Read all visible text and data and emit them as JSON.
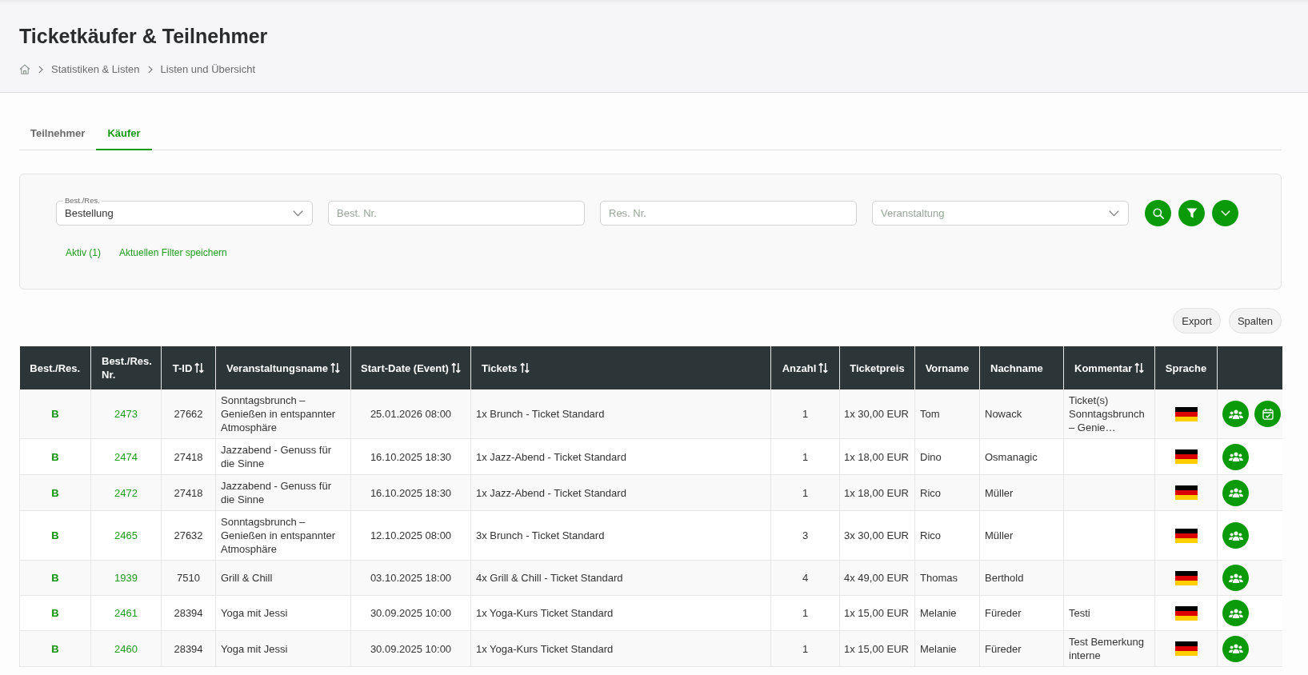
{
  "page": {
    "title": "Ticketkäufer & Teilnehmer",
    "breadcrumb": [
      "Statistiken & Listen",
      "Listen und Übersicht"
    ]
  },
  "tabs": [
    {
      "label": "Teilnehmer",
      "selected": false
    },
    {
      "label": "Käufer",
      "selected": true
    }
  ],
  "filters": {
    "fields": [
      {
        "kind": "select",
        "label": "Best./Res.",
        "value": "Bestellung"
      },
      {
        "kind": "input",
        "placeholder": "Best. Nr."
      },
      {
        "kind": "input",
        "placeholder": "Res. Nr."
      },
      {
        "kind": "select",
        "placeholder": "Veranstaltung"
      }
    ],
    "icon_buttons": [
      {
        "kind": "search"
      },
      {
        "kind": "filter"
      },
      {
        "kind": "expand"
      }
    ],
    "links": [
      "Aktiv (1)",
      "Aktuellen Filter speichern"
    ]
  },
  "toolbar_buttons": [
    "Export",
    "Spalten"
  ],
  "table": {
    "columns": [
      {
        "label": "Best./Res.",
        "sortable": false
      },
      {
        "label": "Best./Res. Nr.",
        "sortable": false
      },
      {
        "label": "T-ID",
        "sortable": true
      },
      {
        "label": "Veranstaltungsname",
        "sortable": true
      },
      {
        "label": "Start-Date (Event)",
        "sortable": true
      },
      {
        "label": "Tickets",
        "sortable": true
      },
      {
        "label": "Anzahl",
        "sortable": true
      },
      {
        "label": "Ticketpreis",
        "sortable": false
      },
      {
        "label": "Vorname",
        "sortable": false
      },
      {
        "label": "Nachname",
        "sortable": false
      },
      {
        "label": "Kommentar",
        "sortable": true
      },
      {
        "label": "Sprache",
        "sortable": false
      }
    ],
    "rows": [
      {
        "type": "B",
        "number": "2473",
        "t_id": "27662",
        "event": "Sonntagsbrunch – Genießen in entspannter Atmosphäre",
        "start": "25.01.2026 08:00",
        "tickets": "1x Brunch - Ticket Standard",
        "count": "1",
        "price": "1x 30,00 EUR",
        "first_name": "Tom",
        "last_name": "Nowack",
        "comment": "Ticket(s) Sonntagsbrunch – Genie…",
        "actions": [
          {
            "kind": "participants"
          },
          {
            "kind": "calendar"
          }
        ]
      },
      {
        "type": "B",
        "number": "2474",
        "t_id": "27418",
        "event": "Jazzabend - Genuss für die Sinne",
        "start": "16.10.2025 18:30",
        "tickets": "1x Jazz-Abend - Ticket Standard",
        "count": "1",
        "price": "1x 18,00 EUR",
        "first_name": "Dino",
        "last_name": "Osmanagic",
        "actions": [
          {
            "kind": "participants"
          }
        ]
      },
      {
        "type": "B",
        "number": "2472",
        "t_id": "27418",
        "event": "Jazzabend - Genuss für die Sinne",
        "start": "16.10.2025 18:30",
        "tickets": "1x Jazz-Abend - Ticket Standard",
        "count": "1",
        "price": "1x 18,00 EUR",
        "first_name": "Rico",
        "last_name": "Müller",
        "actions": [
          {
            "kind": "participants"
          }
        ]
      },
      {
        "type": "B",
        "number": "2465",
        "t_id": "27632",
        "event": "Sonntagsbrunch – Genießen in entspannter Atmosphäre",
        "start": "12.10.2025 08:00",
        "tickets": "3x Brunch - Ticket Standard",
        "count": "3",
        "price": "3x 30,00 EUR",
        "first_name": "Rico",
        "last_name": "Müller",
        "actions": [
          {
            "kind": "participants"
          }
        ]
      },
      {
        "type": "B",
        "number": "1939",
        "t_id": "7510",
        "event": "Grill & Chill",
        "start": "03.10.2025 18:00",
        "tickets": "4x Grill & Chill - Ticket Standard",
        "count": "4",
        "price": "4x 49,00 EUR",
        "first_name": "Thomas",
        "last_name": "Berthold",
        "actions": [
          {
            "kind": "participants"
          }
        ]
      },
      {
        "type": "B",
        "number": "2461",
        "t_id": "28394",
        "event": "Yoga mit Jessi",
        "start": "30.09.2025 10:00",
        "tickets": "1x Yoga-Kurs Ticket Standard",
        "count": "1",
        "price": "1x 15,00 EUR",
        "first_name": "Melanie",
        "last_name": "Füreder",
        "comment": "Testi",
        "actions": [
          {
            "kind": "participants"
          }
        ]
      },
      {
        "type": "B",
        "number": "2460",
        "t_id": "28394",
        "event": "Yoga mit Jessi",
        "start": "30.09.2025 10:00",
        "tickets": "1x Yoga-Kurs Ticket Standard",
        "count": "1",
        "price": "1x 15,00 EUR",
        "first_name": "Melanie",
        "last_name": "Füreder",
        "comment": "Test Bemerkung interne",
        "actions": [
          {
            "kind": "participants"
          }
        ]
      }
    ]
  }
}
